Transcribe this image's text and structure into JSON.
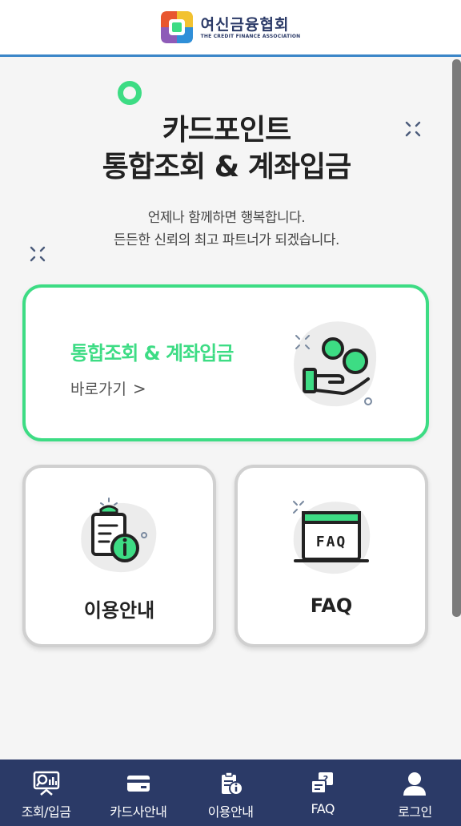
{
  "header": {
    "logo_ko": "여신금융협회",
    "logo_en": "THE CREDIT FINANCE ASSOCIATION"
  },
  "hero": {
    "title_line1": "카드포인트",
    "title_line2": "통합조회 & 계좌입금",
    "sub_line1": "언제나 함께하면 행복합니다.",
    "sub_line2": "든든한 신뢰의 최고 파트너가 되겠습니다."
  },
  "main_card": {
    "title": "통합조회 & 계좌입금",
    "link_label": "바로가기",
    "chevron": ">"
  },
  "cards": {
    "guide_label": "이용안내",
    "faq_label": "FAQ"
  },
  "bottom_nav": {
    "items": [
      {
        "label": "조회/입금",
        "icon": "lookup-icon"
      },
      {
        "label": "카드사안내",
        "icon": "card-icon"
      },
      {
        "label": "이용안내",
        "icon": "guide-icon"
      },
      {
        "label": "FAQ",
        "icon": "faq-icon"
      },
      {
        "label": "로그인",
        "icon": "user-icon"
      }
    ]
  },
  "colors": {
    "accent": "#3ddc84",
    "nav_bg": "#2b3a67",
    "header_line": "#3b86c8"
  }
}
